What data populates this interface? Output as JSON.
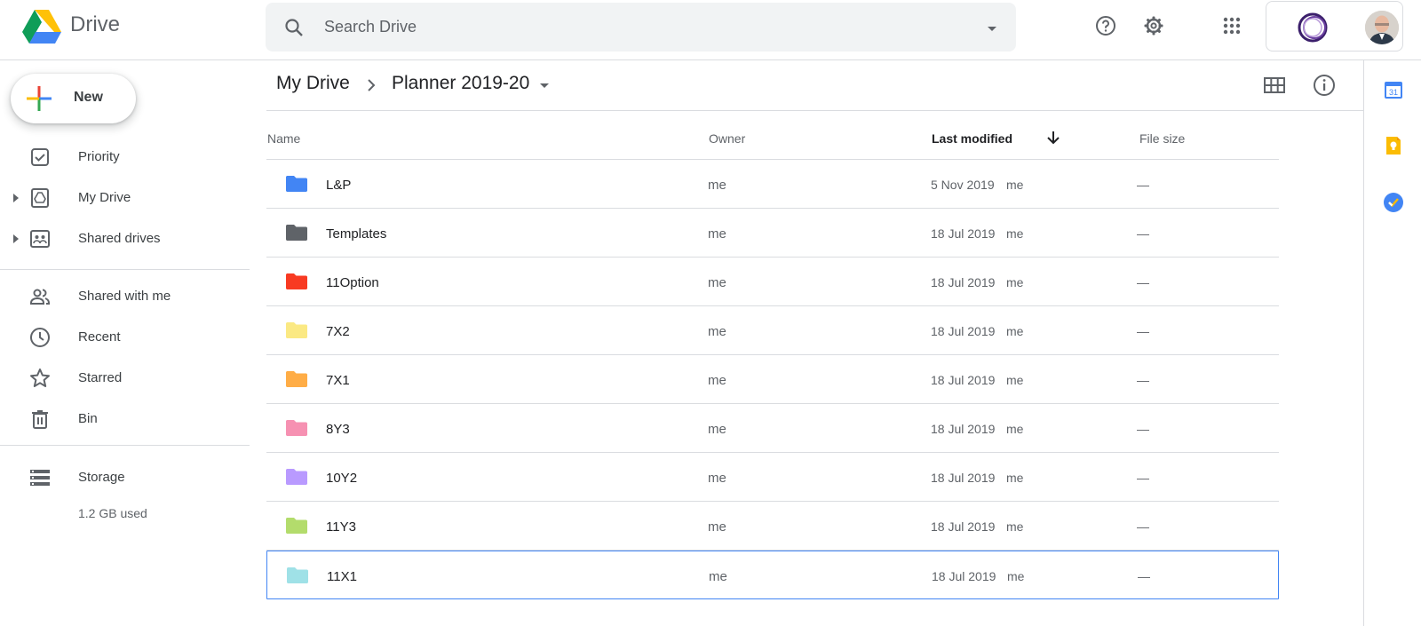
{
  "app": {
    "name": "Drive"
  },
  "header": {
    "search_placeholder": "Search Drive",
    "icons": [
      "search-icon",
      "search-options-icon",
      "help-icon",
      "settings-icon",
      "apps-grid-icon"
    ],
    "org_logo": "organisation-logo",
    "avatar": "user-avatar"
  },
  "sidebar": {
    "new_label": "New",
    "items": [
      {
        "label": "Priority",
        "icon": "priority-icon"
      },
      {
        "label": "My Drive",
        "icon": "my-drive-icon",
        "expandable": true
      },
      {
        "label": "Shared drives",
        "icon": "shared-drives-icon",
        "expandable": true
      },
      {
        "label": "Shared with me",
        "icon": "shared-with-me-icon"
      },
      {
        "label": "Recent",
        "icon": "recent-icon"
      },
      {
        "label": "Starred",
        "icon": "star-icon"
      },
      {
        "label": "Bin",
        "icon": "bin-icon"
      },
      {
        "label": "Storage",
        "icon": "storage-icon"
      }
    ],
    "storage_used": "1.2 GB used"
  },
  "breadcrumb": {
    "root": "My Drive",
    "current": "Planner 2019-20"
  },
  "table": {
    "columns": {
      "name": "Name",
      "owner": "Owner",
      "modified": "Last modified",
      "size": "File size"
    },
    "sort": {
      "column": "Last modified",
      "direction": "descending"
    },
    "rows": [
      {
        "name": "L&P",
        "owner": "me",
        "date": "5 Nov 2019",
        "by": "me",
        "size": "—",
        "color": "#4285f4"
      },
      {
        "name": "Templates",
        "owner": "me",
        "date": "18 Jul 2019",
        "by": "me",
        "size": "—",
        "color": "#5f6368"
      },
      {
        "name": "11Option",
        "owner": "me",
        "date": "18 Jul 2019",
        "by": "me",
        "size": "—",
        "color": "#f83a22"
      },
      {
        "name": "7X2",
        "owner": "me",
        "date": "18 Jul 2019",
        "by": "me",
        "size": "—",
        "color": "#fbe983"
      },
      {
        "name": "7X1",
        "owner": "me",
        "date": "18 Jul 2019",
        "by": "me",
        "size": "—",
        "color": "#ffad46"
      },
      {
        "name": "8Y3",
        "owner": "me",
        "date": "18 Jul 2019",
        "by": "me",
        "size": "—",
        "color": "#f691b2"
      },
      {
        "name": "10Y2",
        "owner": "me",
        "date": "18 Jul 2019",
        "by": "me",
        "size": "—",
        "color": "#b99aff"
      },
      {
        "name": "11Y3",
        "owner": "me",
        "date": "18 Jul 2019",
        "by": "me",
        "size": "—",
        "color": "#b3dc6c"
      },
      {
        "name": "11X1",
        "owner": "me",
        "date": "18 Jul 2019",
        "by": "me",
        "size": "—",
        "color": "#9fe1e7",
        "selected": true
      }
    ]
  },
  "right_panel": {
    "calendar_day": "31",
    "icons": [
      "calendar-icon",
      "keep-icon",
      "tasks-icon"
    ]
  },
  "colors": {
    "accent": "#4285f4",
    "divider": "#dadce0"
  }
}
